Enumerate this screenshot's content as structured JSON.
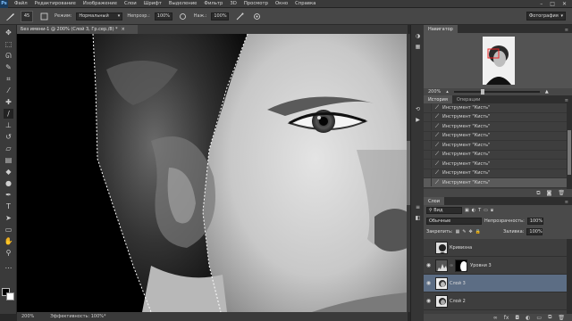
{
  "menubar": {
    "logo": "Ps",
    "items": [
      "Файл",
      "Редактирование",
      "Изображение",
      "Слои",
      "Шрифт",
      "Выделение",
      "Фильтр",
      "3D",
      "Просмотр",
      "Окно",
      "Справка"
    ],
    "controls": [
      "–",
      "□",
      "✕"
    ]
  },
  "options": {
    "brush_size": "45",
    "mode_label": "Режим:",
    "mode_value": "Нормальный",
    "opacity_label": "Непрозр.:",
    "opacity_value": "100%",
    "flow_label": "Наж.:",
    "flow_value": "100%",
    "workspace": "Фотография"
  },
  "document": {
    "tab_title": "Без имени-1 @ 200% (Слой 3, Гр.сер./8) *",
    "tab_close": "×"
  },
  "status": {
    "zoom": "200%",
    "info": "Эффективность: 100%*"
  },
  "navigator": {
    "tab_label": "Навигатор",
    "zoom": "200%"
  },
  "history": {
    "tabs": [
      "История",
      "Операции"
    ],
    "items": [
      "Инструмент \"Кисть\"",
      "Инструмент \"Кисть\"",
      "Инструмент \"Кисть\"",
      "Инструмент \"Кисть\"",
      "Инструмент \"Кисть\"",
      "Инструмент \"Кисть\"",
      "Инструмент \"Кисть\"",
      "Инструмент \"Кисть\"",
      "Инструмент \"Кисть\""
    ]
  },
  "layers": {
    "tab_label": "Слои",
    "filter_label": "Вид",
    "blend_mode": "Обычные",
    "opacity_label": "Непрозрачность:",
    "opacity_value": "100%",
    "lock_label": "Закрепить:",
    "fill_label": "Заливка:",
    "fill_value": "100%",
    "items": [
      {
        "name": "Кривизна",
        "visible": false,
        "has_mask": false
      },
      {
        "name": "Уровни 3",
        "visible": true,
        "has_mask": true
      },
      {
        "name": "Слой 3",
        "visible": true,
        "has_mask": false
      },
      {
        "name": "Слой 2",
        "visible": true,
        "has_mask": false
      }
    ]
  },
  "colors": {
    "active_layer": "#5c6d84",
    "panel_bg": "#424242",
    "canvas_bg": "#000000"
  }
}
